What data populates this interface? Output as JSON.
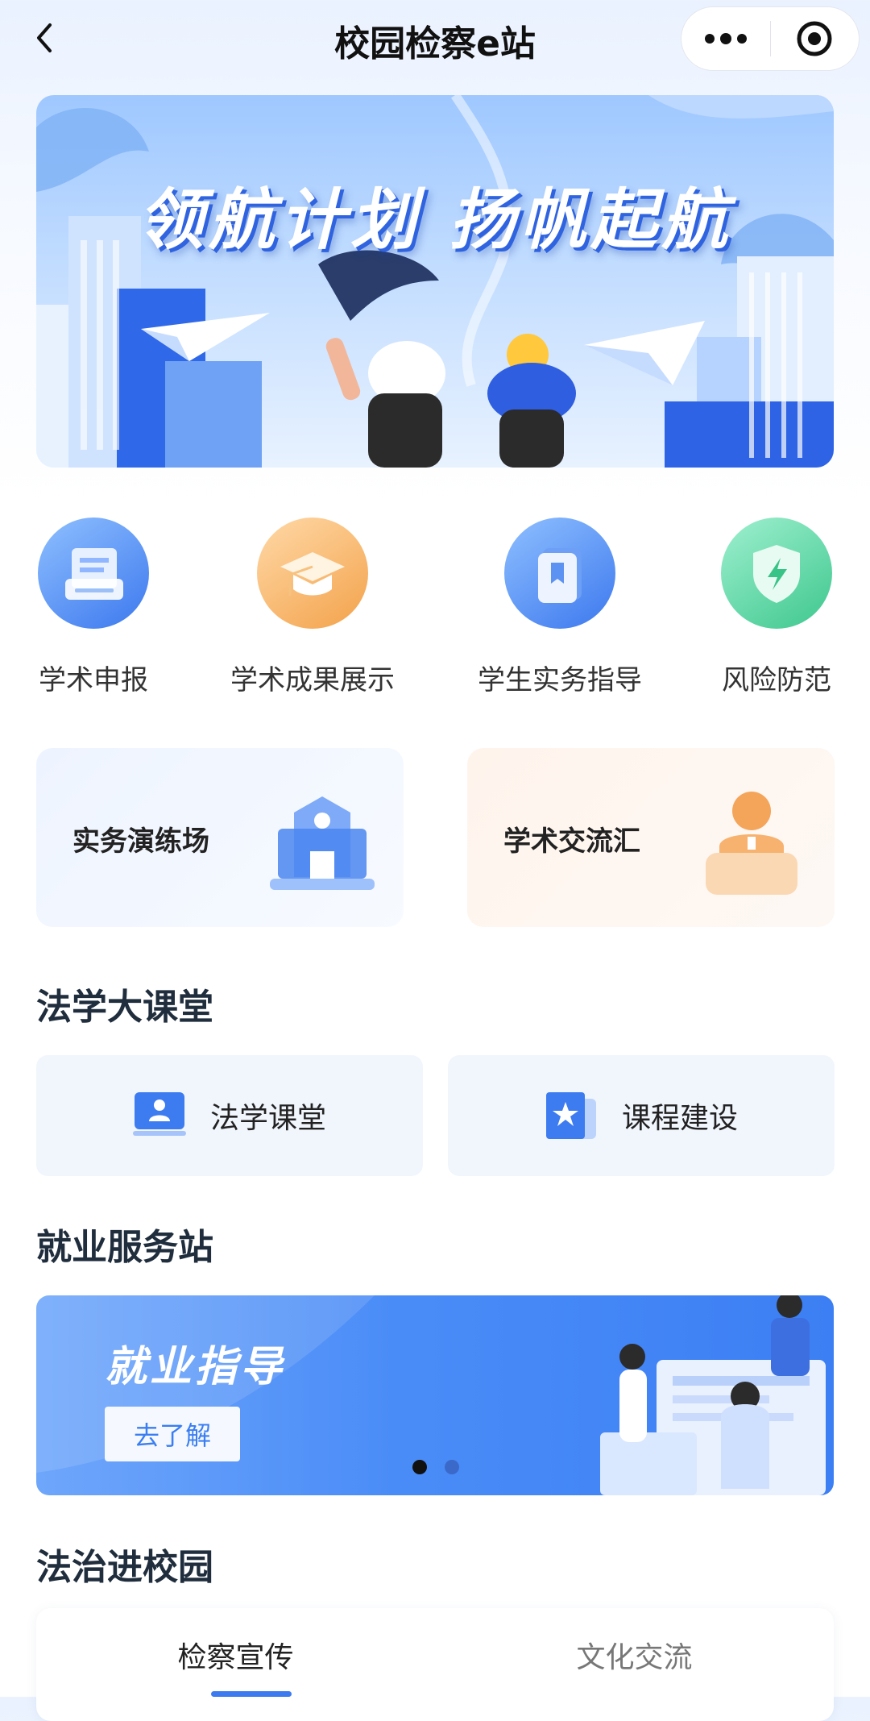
{
  "header": {
    "title": "校园检察e站"
  },
  "hero": {
    "title": "领航计划 扬帆起航"
  },
  "quick_icons": [
    {
      "label": "学术申报",
      "icon": "scanner-icon"
    },
    {
      "label": "学术成果展示",
      "icon": "graduation-cap-icon"
    },
    {
      "label": "学生实务指导",
      "icon": "book-icon"
    },
    {
      "label": "风险防范",
      "icon": "shield-lightning-icon"
    }
  ],
  "feature_cards": [
    {
      "label": "实务演练场",
      "icon": "building-icon"
    },
    {
      "label": "学术交流汇",
      "icon": "speaker-podium-icon"
    }
  ],
  "law_class": {
    "title": "法学大课堂",
    "items": [
      {
        "label": "法学课堂",
        "icon": "presenter-icon"
      },
      {
        "label": "课程建设",
        "icon": "star-document-icon"
      }
    ]
  },
  "employment": {
    "title": "就业服务站",
    "banner": {
      "title": "就业指导",
      "button": "去了解"
    }
  },
  "law_campus": {
    "title": "法治进校园",
    "tabs": [
      {
        "label": "检察宣传",
        "active": true
      },
      {
        "label": "文化交流",
        "active": false
      }
    ]
  },
  "colors": {
    "accent": "#3c7bef",
    "text": "#1f2d3d"
  }
}
